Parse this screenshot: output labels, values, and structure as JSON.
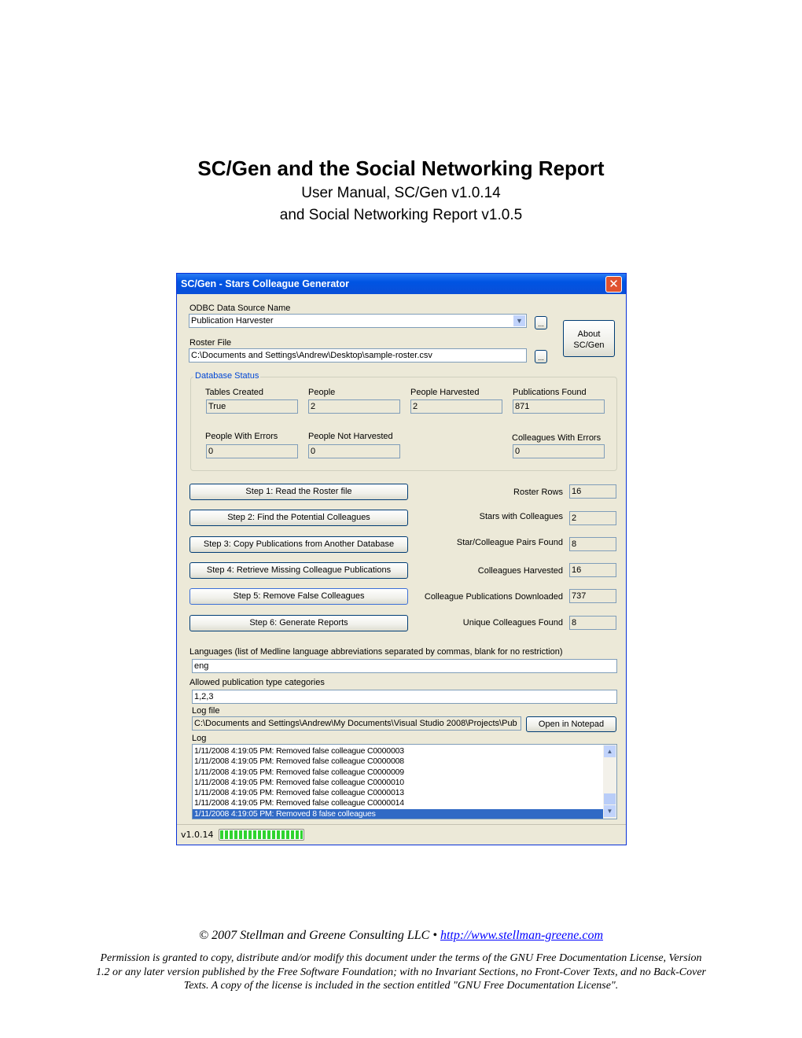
{
  "document": {
    "title": "SC/Gen and the Social Networking Report",
    "subtitle_line1": "User Manual, SC/Gen v1.0.14",
    "subtitle_line2": "and Social Networking Report v1.0.5",
    "copyright": "© 2007 Stellman and Greene Consulting LLC •",
    "link": "http://www.stellman-greene.com",
    "permission_line1": "Permission is granted to copy, distribute and/or modify this document under the terms of the GNU Free Documentation License, Version",
    "permission_line2": "1.2 or any later version published by the Free Software Foundation; with no Invariant Sections, no Front-Cover Texts, and no Back-Cover",
    "permission_line3": "Texts.  A copy of the license is included in the section entitled \"GNU Free Documentation License\"."
  },
  "window": {
    "title": "SC/Gen - Stars Colleague Generator",
    "close_icon": "close-icon",
    "odbc_label": "ODBC Data Source Name",
    "odbc_value": "Publication Harvester",
    "browse_label": "...",
    "about_line1": "About",
    "about_line2": "SC/Gen",
    "roster_label": "Roster File",
    "roster_value": "C:\\Documents and Settings\\Andrew\\Desktop\\sample-roster.csv",
    "db_status": {
      "legend": "Database Status",
      "fields": [
        {
          "label": "Tables Created",
          "value": "True"
        },
        {
          "label": "People",
          "value": "2"
        },
        {
          "label": "People Harvested",
          "value": "2"
        },
        {
          "label": "Publications Found",
          "value": "871"
        },
        {
          "label": "People With Errors",
          "value": "0"
        },
        {
          "label": "People Not Harvested",
          "value": "0"
        },
        {
          "label": "Colleagues With Errors",
          "value": "0"
        }
      ]
    },
    "steps": [
      "Step 1: Read the Roster file",
      "Step 2: Find the Potential Colleagues",
      "Step 3: Copy Publications from Another Database",
      "Step 4: Retrieve Missing Colleague Publications",
      "Step 5: Remove False Colleagues",
      "Step 6: Generate Reports"
    ],
    "stats": [
      {
        "label": "Roster Rows",
        "value": "16"
      },
      {
        "label": "Stars with Colleagues",
        "value": "2"
      },
      {
        "label": "Star/Colleague Pairs Found",
        "value": "8"
      },
      {
        "label": "Colleagues Harvested",
        "value": "16"
      },
      {
        "label": "Colleague Publications Downloaded",
        "value": "737"
      },
      {
        "label": "Unique Colleagues Found",
        "value": "8"
      }
    ],
    "languages_label": "Languages (list of Medline language abbreviations separated by commas, blank for no restriction)",
    "languages_value": "eng",
    "pubtypes_label": "Allowed publication type categories",
    "pubtypes_value": "1,2,3",
    "logfile_label": "Log file",
    "logfile_value": "C:\\Documents and Settings\\Andrew\\My Documents\\Visual Studio 2008\\Projects\\Pub",
    "open_notepad": "Open in Notepad",
    "log_label": "Log",
    "log": [
      "1/11/2008 4:19:05 PM: Removed false colleague C0000003",
      "1/11/2008 4:19:05 PM: Removed false colleague C0000008",
      "1/11/2008 4:19:05 PM: Removed false colleague C0000009",
      "1/11/2008 4:19:05 PM: Removed false colleague C0000010",
      "1/11/2008 4:19:05 PM: Removed false colleague C0000013",
      "1/11/2008 4:19:05 PM: Removed false colleague C0000014",
      "1/11/2008 4:19:05 PM: Removed 8 false colleagues"
    ],
    "version": "v1.0.14",
    "progress_percent": 100,
    "colors": {
      "titlebar": "#0054e3",
      "window_bg": "#ece9d8",
      "progress": "#2fd32f",
      "selection": "#316ac5",
      "legend": "#0046d5"
    }
  }
}
